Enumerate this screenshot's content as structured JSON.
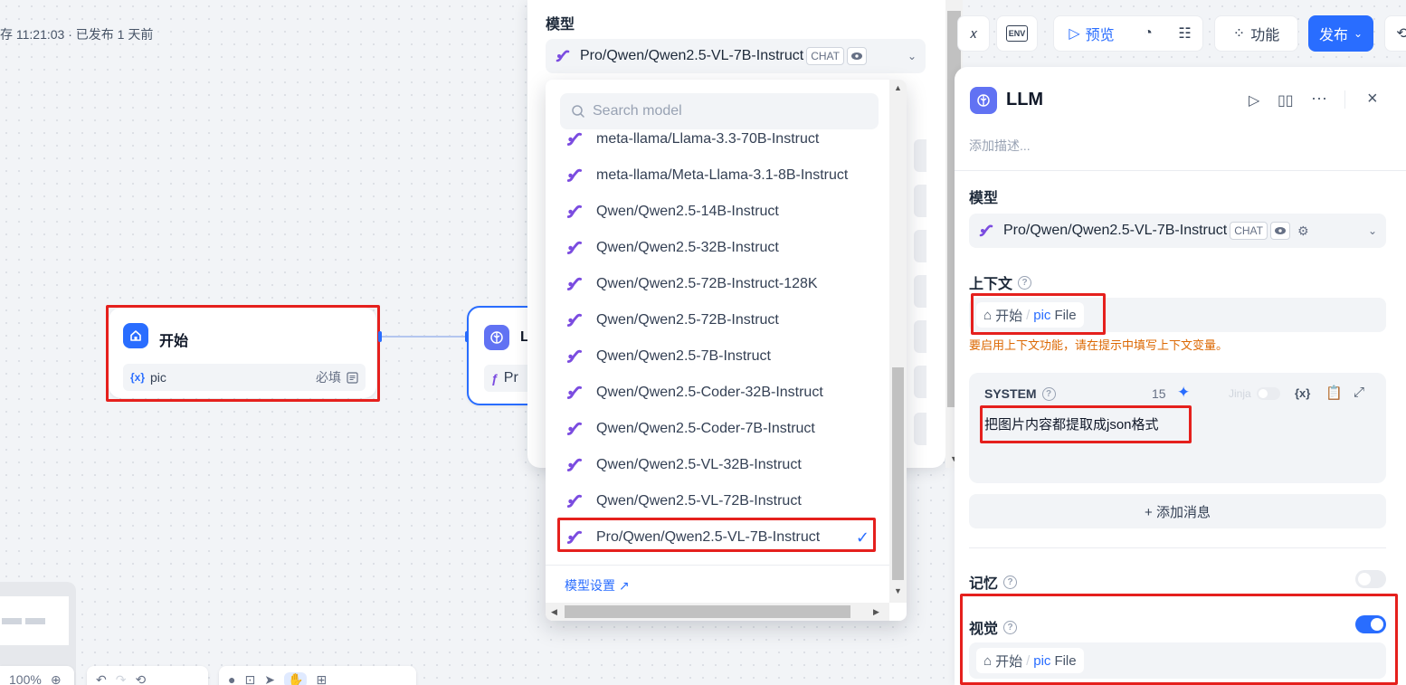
{
  "canvas": {
    "status": "存 11:21:03 · 已发布 1 天前",
    "start_node": {
      "title": "开始",
      "var_tag": "{x}",
      "var_name": "pic",
      "required": "必填"
    },
    "llm_node": {
      "title": "L",
      "model_prefix": "Pr"
    },
    "zoom": "100%"
  },
  "model_panel": {
    "label": "模型",
    "selected_model": "Pro/Qwen/Qwen2.5-VL-7B-Instruct",
    "mode_chip": "CHAT"
  },
  "dropdown": {
    "search_placeholder": "Search model",
    "items": [
      "meta-llama/Llama-3.3-70B-Instruct",
      "meta-llama/Meta-Llama-3.1-8B-Instruct",
      "Qwen/Qwen2.5-14B-Instruct",
      "Qwen/Qwen2.5-32B-Instruct",
      "Qwen/Qwen2.5-72B-Instruct-128K",
      "Qwen/Qwen2.5-72B-Instruct",
      "Qwen/Qwen2.5-7B-Instruct",
      "Qwen/Qwen2.5-Coder-32B-Instruct",
      "Qwen/Qwen2.5-Coder-7B-Instruct",
      "Qwen/Qwen2.5-VL-32B-Instruct",
      "Qwen/Qwen2.5-VL-72B-Instruct",
      "Pro/Qwen/Qwen2.5-VL-7B-Instruct"
    ],
    "selected_index": 11,
    "footer_link": "模型设置 ↗"
  },
  "toolbar": {
    "env_label": "ENV",
    "preview_label": "预览",
    "features_label": "功能",
    "publish_label": "发布"
  },
  "llm_panel": {
    "title": "LLM",
    "description_placeholder": "添加描述...",
    "model_label": "模型",
    "model_value": "Pro/Qwen/Qwen2.5-VL-7B-Instruct",
    "model_chip": "CHAT",
    "context_label": "上下文",
    "context_ref": {
      "node": "开始",
      "var": "pic",
      "type": "File"
    },
    "context_warning": "要启用上下文功能，请在提示中填写上下文变量。",
    "system": {
      "label": "SYSTEM",
      "count": "15",
      "jinja": "Jinja",
      "var_icon": "{x}",
      "content": "把图片内容都提取成json格式"
    },
    "add_message": "+ 添加消息",
    "memory_label": "记忆",
    "memory_enabled": false,
    "vision_label": "视觉",
    "vision_enabled": true,
    "vision_ref": {
      "node": "开始",
      "var": "pic",
      "type": "File"
    }
  },
  "colors": {
    "accent": "#296dff",
    "llm_icon": "#6172f3",
    "highlight": "#e5201d",
    "warning": "#dc6803",
    "logo_purple": "#7b4ce0"
  }
}
